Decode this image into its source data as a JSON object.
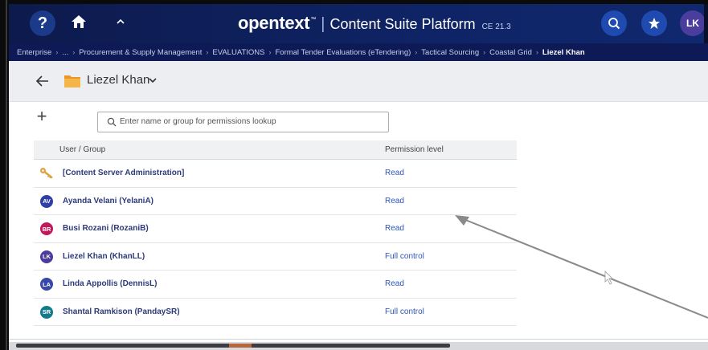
{
  "header": {
    "help_label": "?",
    "brand_logo": "opentext",
    "brand_tm": "™",
    "brand_separator": "|",
    "brand_product": "Content Suite Platform",
    "brand_version": "CE 21.3",
    "avatar_initials": "LK"
  },
  "breadcrumb": [
    "Enterprise",
    "...",
    "Procurement & Supply Management",
    "EVALUATIONS",
    "Formal Tender Evaluations (eTendering)",
    "Tactical Sourcing",
    "Coastal Grid",
    "Liezel Khan"
  ],
  "title_bar": {
    "node_title": "Liezel Khan"
  },
  "toolbar": {
    "add_label": "+",
    "search_placeholder": "Enter name or group for permissions lookup"
  },
  "table": {
    "headers": {
      "user": "User / Group",
      "permission": "Permission level"
    },
    "rows": [
      {
        "name": "[Content Server Administration]",
        "permission": "Read",
        "icon": "key-icon",
        "initials": "",
        "color": "#d9a441"
      },
      {
        "name": "Ayanda Velani (YelaniA)",
        "permission": "Read",
        "icon": "avatar",
        "initials": "AV",
        "color": "#2f3fa8"
      },
      {
        "name": "Busi Rozani (RozaniB)",
        "permission": "Read",
        "icon": "avatar",
        "initials": "BR",
        "color": "#c2185b"
      },
      {
        "name": "Liezel Khan (KhanLL)",
        "permission": "Full control",
        "icon": "avatar",
        "initials": "LK",
        "color": "#4a3d9e"
      },
      {
        "name": "Linda Appollis (DennisL)",
        "permission": "Read",
        "icon": "avatar",
        "initials": "LA",
        "color": "#3848a8"
      },
      {
        "name": "Shantal Ramkison (PandaySR)",
        "permission": "Full control",
        "icon": "avatar",
        "initials": "SR",
        "color": "#117a8b"
      }
    ]
  },
  "colors": {
    "header_bg": "#0f2466",
    "breadcrumb_bg": "#0d1a55",
    "link_blue": "#2d55b8",
    "folder_orange": "#f2a93b"
  }
}
